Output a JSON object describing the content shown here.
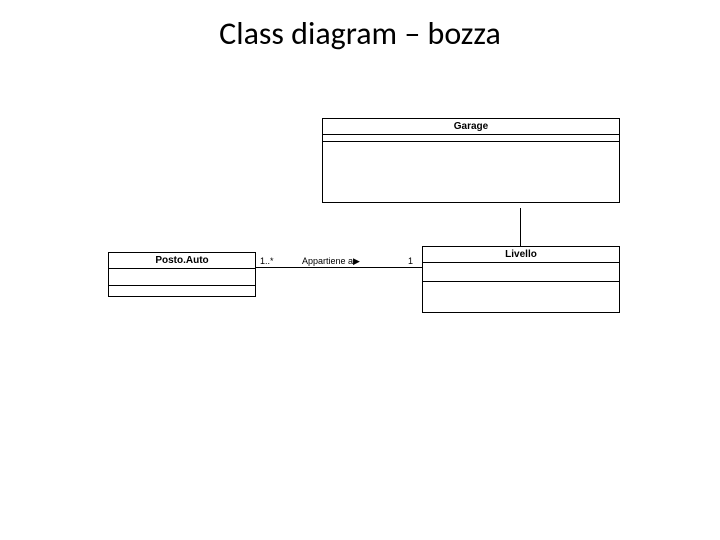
{
  "title": "Class diagram – bozza",
  "classes": {
    "garage": {
      "name": "Garage"
    },
    "livello": {
      "name": "Livello"
    },
    "postoauto": {
      "name": "Posto.Auto"
    }
  },
  "assoc": {
    "name": "Appartiene a▶",
    "mult_left": "1..*",
    "mult_right": "1"
  }
}
